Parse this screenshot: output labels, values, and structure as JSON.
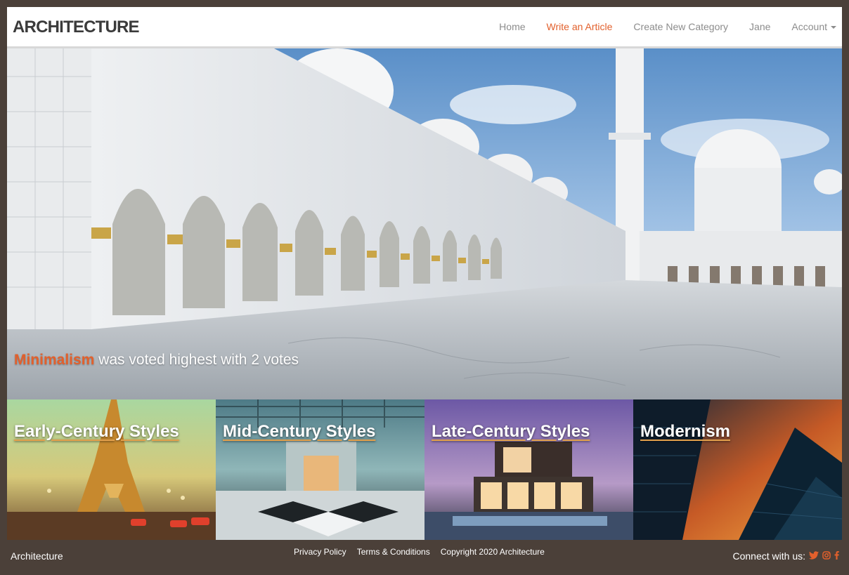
{
  "navbar": {
    "brand": "ARCHITECTURE",
    "links": {
      "home": "Home",
      "write": "Write an Article",
      "category": "Create New Category",
      "user": "Jane",
      "account": "Account"
    }
  },
  "hero": {
    "winner": "Minimalism",
    "caption_rest": " was voted highest with 2 votes"
  },
  "cards": [
    {
      "title": "Early-Century Styles"
    },
    {
      "title": "Mid-Century Styles"
    },
    {
      "title": "Late-Century Styles"
    },
    {
      "title": "Modernism"
    }
  ],
  "footer": {
    "brand": "Architecture",
    "privacy": "Privacy Policy",
    "terms": "Terms & Conditions",
    "copyright": "Copyright 2020 Architecture",
    "connect": "Connect with us:"
  },
  "colors": {
    "accent": "#e2602c",
    "page_bg": "#4b4039",
    "nav_text": "#8c8c8c"
  },
  "icons": [
    "twitter-icon",
    "instagram-icon",
    "facebook-icon",
    "caret-down-icon"
  ]
}
